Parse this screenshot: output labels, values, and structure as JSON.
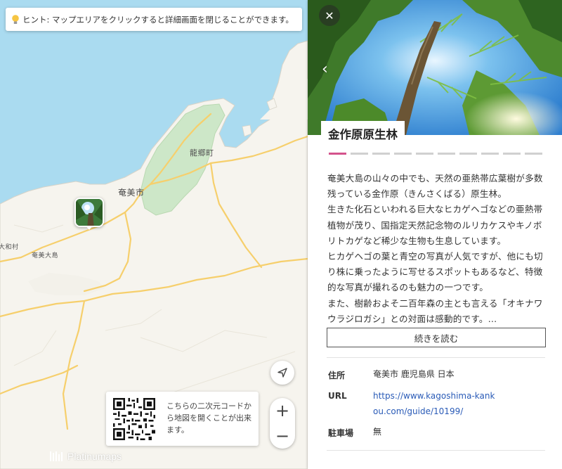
{
  "map": {
    "hint": "ヒント: マップエリアをクリックすると詳細画面を閉じることができます。",
    "labels": {
      "tatsugo": "龍郷町",
      "amami_city": "奄美市",
      "yamato_village": "大和村",
      "amami_oshima": "奄美大島"
    },
    "qr_text": "こちらの二次元コードから地図を開くことが出来ます。",
    "brand": "Platinumaps",
    "zoom_in": "+",
    "zoom_out": "−"
  },
  "panel": {
    "close": "✕",
    "prev": "‹",
    "title": "金作原原生林",
    "dots_total": 10,
    "dots_active": 0,
    "description": [
      "奄美大島の山々の中でも、天然の亜熱帯広葉樹が多数残っている金作原（きんさくばる）原生林。",
      "生きた化石といわれる巨大なヒカゲヘゴなどの亜熱帯植物が茂り、国指定天然記念物のルリカケスやキノボリトカゲなど稀少な生物も生息しています。",
      "ヒカゲヘゴの葉と青空の写真が人気ですが、他にも切り株に乗ったように写せるスポットもあるなど、特徴的な写真が撮れるのも魅力の一つです。",
      "また、樹齢およそ二百年森の主とも言える「オキナワウラジロガシ」との対面は感動的です。…"
    ],
    "read_more": "続きを読む",
    "info": {
      "address_label": "住所",
      "address_value": "奄美市 鹿児島県 日本",
      "url_label": "URL",
      "url_value": "https://www.kagoshima-kankou.com/guide/10199/",
      "parking_label": "駐車場",
      "parking_value": "無"
    }
  },
  "colors": {
    "sea": "#aadbf0",
    "land": "#f6f4ee",
    "forest": "#cde7c8",
    "road": "#f6cf6c",
    "accent": "#d4538c",
    "link": "#2a5bb7"
  }
}
